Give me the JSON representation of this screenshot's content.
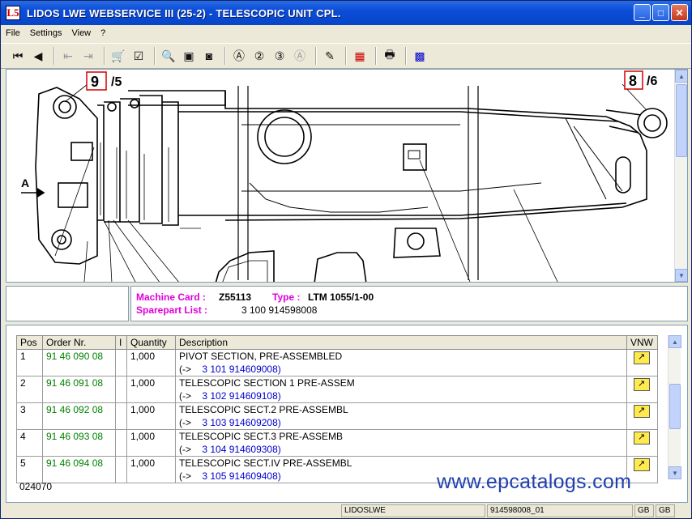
{
  "window": {
    "app_letter": "L5",
    "title": "LIDOS LWE WEBSERVICE III (25-2) - TELESCOPIC UNIT CPL."
  },
  "menu": [
    "File",
    "Settings",
    "View",
    "?"
  ],
  "drawing": {
    "callout_left_num": "9",
    "callout_left_sheet": "/5",
    "callout_right_num": "8",
    "callout_right_sheet": "/6",
    "arrow_label": "A"
  },
  "info": {
    "machine_card_label": "Machine Card :",
    "machine_card_value": "Z55113",
    "type_label": "Type :",
    "type_value": "LTM 1055/1-00",
    "sparepart_label": "Sparepart List :",
    "sparepart_value": "3 100 914598008"
  },
  "table": {
    "headers": {
      "pos": "Pos",
      "order": "Order Nr.",
      "i": "I",
      "qty": "Quantity",
      "desc": "Description",
      "vnw": "VNW"
    },
    "rows": [
      {
        "pos": "1",
        "order": "91 46 090 08",
        "qty": "1,000",
        "desc": "PIVOT SECTION, PRE-ASSEMBLED",
        "ref_prefix": "(->",
        "ref": "3 101 914609008)"
      },
      {
        "pos": "2",
        "order": "91 46 091 08",
        "qty": "1,000",
        "desc": "TELESCOPIC SECTION 1 PRE-ASSEM",
        "ref_prefix": "(->",
        "ref": "3 102 914609108)"
      },
      {
        "pos": "3",
        "order": "91 46 092 08",
        "qty": "1,000",
        "desc": "TELESCOPIC SECT.2 PRE-ASSEMBL",
        "ref_prefix": "(->",
        "ref": "3 103 914609208)"
      },
      {
        "pos": "4",
        "order": "91 46 093 08",
        "qty": "1,000",
        "desc": "TELESCOPIC SECT.3 PRE-ASSEMB",
        "ref_prefix": "(->",
        "ref": "3 104 914609308)"
      },
      {
        "pos": "5",
        "order": "91 46 094 08",
        "qty": "1,000",
        "desc": "TELESCOPIC SECT.IV PRE-ASSEMBL",
        "ref_prefix": "(->",
        "ref": "3 105 914609408)"
      }
    ]
  },
  "footer_code": "024070",
  "watermark": "www.epcatalogs.com",
  "status": {
    "app": "LIDOSLWE",
    "list_id": "914598008_01",
    "lang1": "GB",
    "lang2": "GB"
  },
  "icons": {
    "first": "first-page-icon",
    "prev": "prev-icon",
    "zoom": "zoom-in-icon",
    "print": "printer-icon",
    "grid": "grid-icon"
  }
}
